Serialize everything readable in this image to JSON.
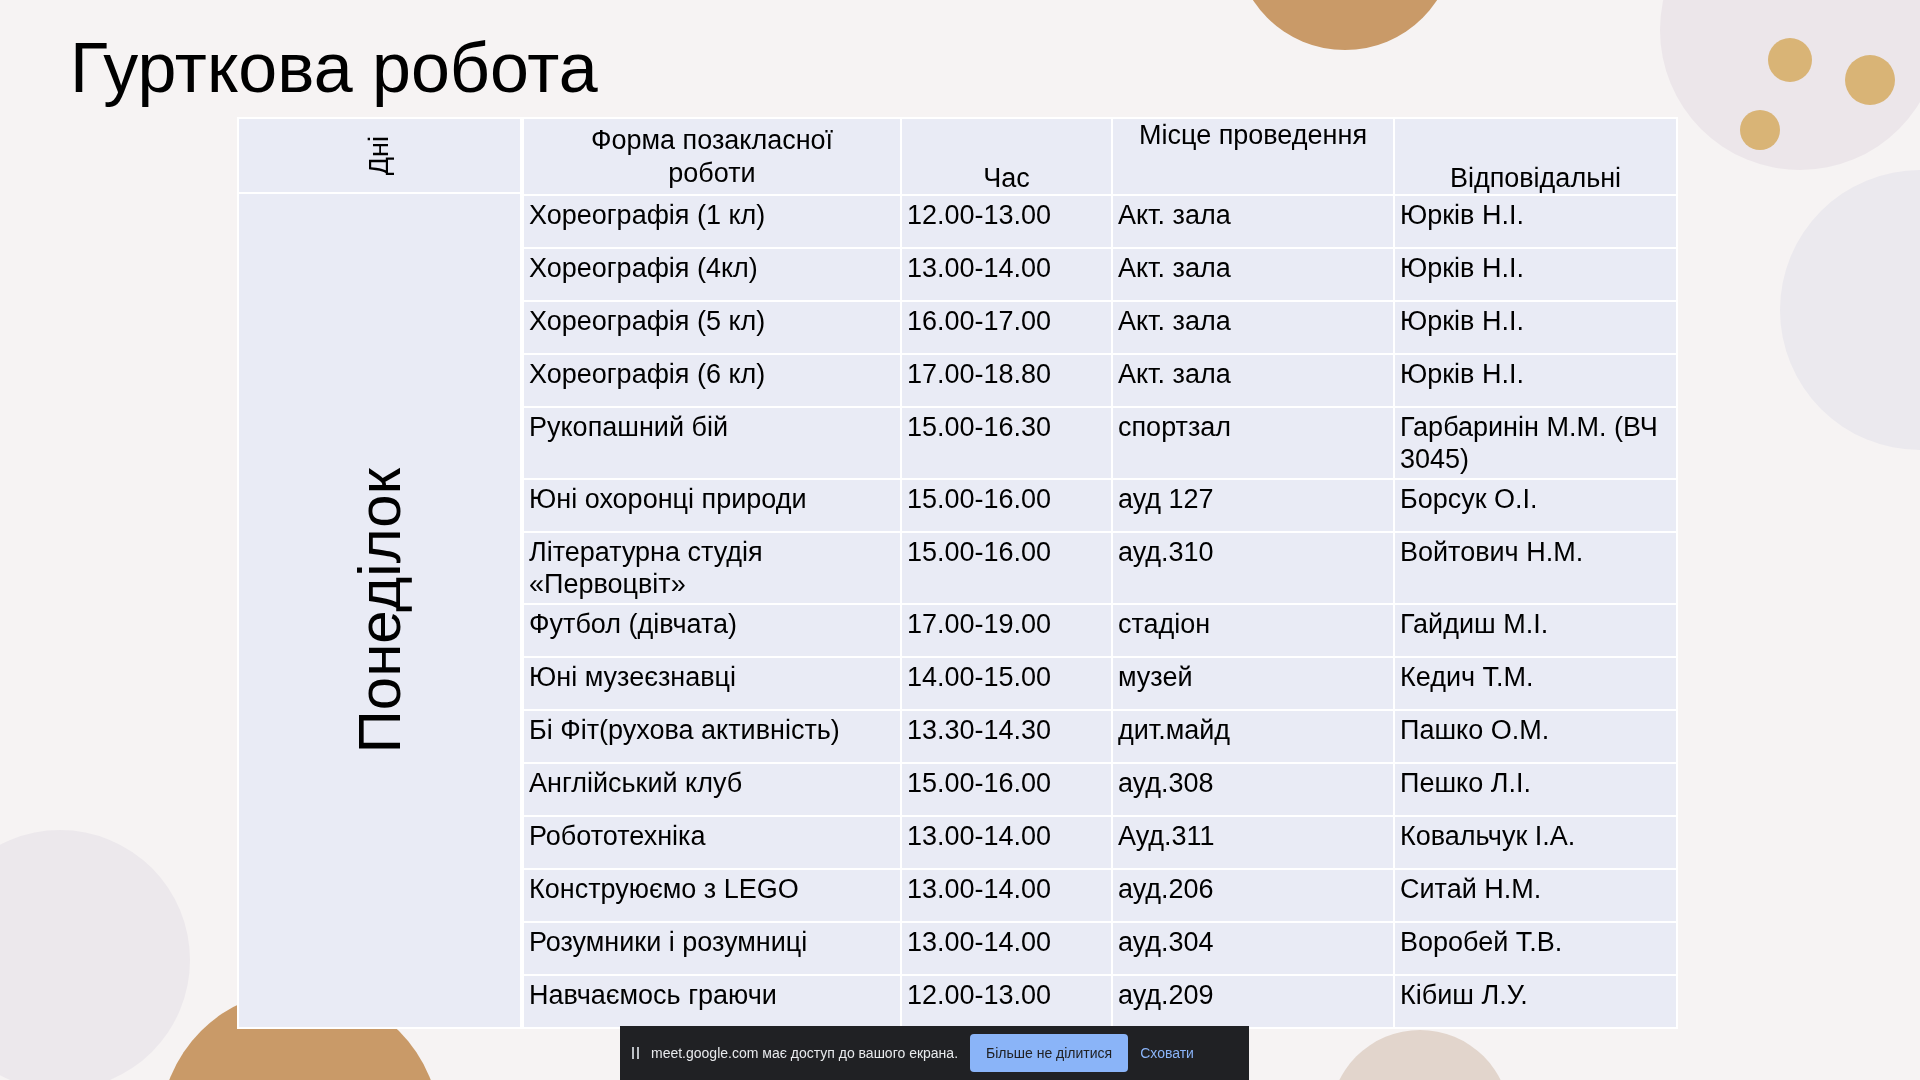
{
  "slide": {
    "title": "Гурткова робота"
  },
  "day_column": {
    "header": "Дні",
    "label": "Понеділок"
  },
  "table": {
    "columns": [
      "Форма позакласної роботи",
      "Час",
      "Місце проведення",
      "Відповідальні"
    ],
    "rows": [
      [
        "Хореографія (1 кл)",
        "12.00-13.00",
        "Акт. зала",
        "Юрків Н.І."
      ],
      [
        "Хореографія (4кл)",
        "13.00-14.00",
        "Акт. зала",
        "Юрків Н.І."
      ],
      [
        "Хореографія (5 кл)",
        "16.00-17.00",
        "Акт. зала",
        "Юрків Н.І."
      ],
      [
        "Хореографія (6 кл)",
        "17.00-18.80",
        "Акт. зала",
        "Юрків Н.І."
      ],
      [
        "Рукопашний бій",
        "15.00-16.30",
        "спортзал",
        "Гарбаринін М.М. (ВЧ 3045)"
      ],
      [
        "Юні охоронці природи",
        "15.00-16.00",
        "ауд 127",
        "Борсук О.І."
      ],
      [
        "Літературна студія «Первоцвіт»",
        "15.00-16.00",
        "ауд.310",
        "Войтович Н.М."
      ],
      [
        "Футбол (дівчата)",
        "17.00-19.00",
        "стадіон",
        "Гайдиш М.І."
      ],
      [
        "Юні музеєзнавці",
        "14.00-15.00",
        "музей",
        "Кедич Т.М."
      ],
      [
        "Бі Фіт(рухова активність)",
        "13.30-14.30",
        "дит.майд",
        "Пашко О.М."
      ],
      [
        "Англійський клуб",
        "15.00-16.00",
        "ауд.308",
        "Пешко Л.І."
      ],
      [
        "Робототехніка",
        "13.00-14.00",
        "Ауд.311",
        "Ковальчук І.А."
      ],
      [
        "Конструюємо з LEGO",
        "13.00-14.00",
        "ауд.206",
        "Ситай Н.М."
      ],
      [
        "Розумники і розумниці",
        "13.00-14.00",
        "ауд.304",
        "Воробей Т.В."
      ],
      [
        "Навчаємось граючи",
        "12.00-13.00",
        "ауд.209",
        "Кібиш Л.У."
      ]
    ]
  },
  "share_bar": {
    "message": "meet.google.com має доступ до вашого екрана.",
    "stop_button": "Більше не ділитися",
    "hide_link": "Сховати"
  }
}
